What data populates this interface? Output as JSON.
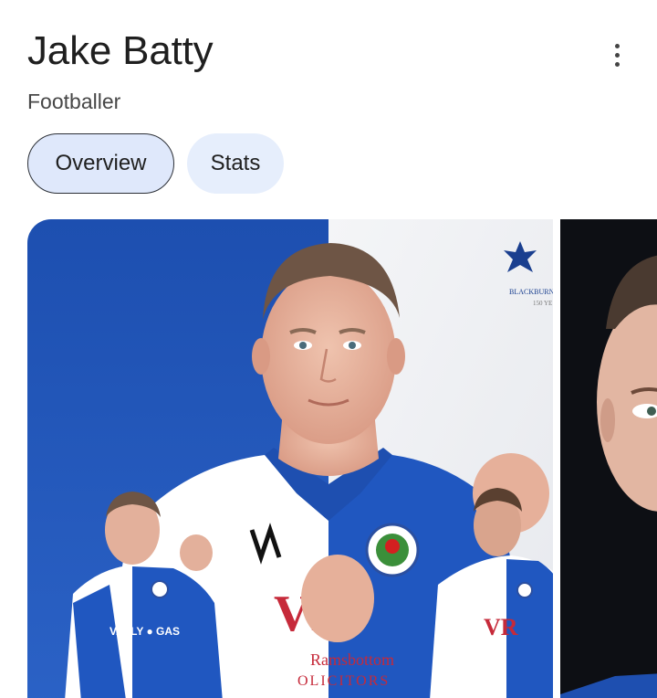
{
  "header": {
    "title": "Jake Batty",
    "subtitle": "Footballer"
  },
  "tabs": [
    {
      "label": "Overview",
      "active": true
    },
    {
      "label": "Stats",
      "active": false
    }
  ],
  "images": {
    "main": {
      "crest_text": "BLACKBURN",
      "crest_year": "150 YE",
      "sponsor": "VR",
      "sponsor_sub": "Ramsbottom",
      "sponsor_sub2": "OLICITORS",
      "small_sponsor": "VR"
    }
  },
  "colors": {
    "accent_blue": "#1a56b8",
    "chip_active_bg": "#dfe8fb",
    "chip_bg": "#e6eefc"
  },
  "icons": {
    "more": "more-vert-icon"
  }
}
